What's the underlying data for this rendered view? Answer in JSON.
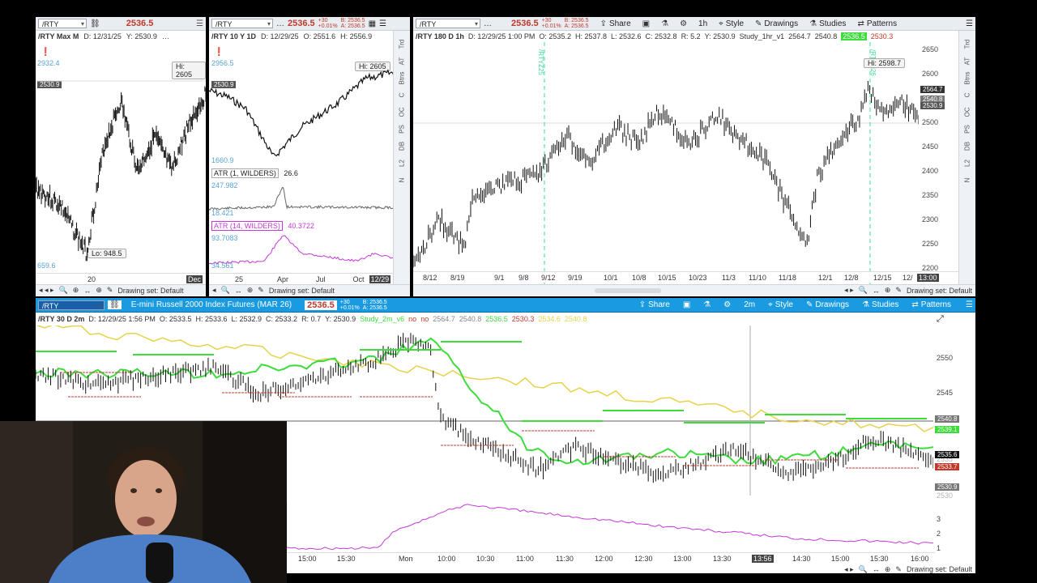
{
  "top_left": {
    "symbol": "/RTY",
    "price": "2536.5",
    "info": [
      "/RTY Max M",
      "D: 12/31/25",
      "Y: 2530.9"
    ],
    "hi_label": "Hi: 2605",
    "lo_label": "Lo: 948.5",
    "axis_top": "2932.4",
    "axis_bottom": "659.6",
    "cur_tag": "2530.9",
    "x_ticks": [
      "20",
      "Dec"
    ],
    "drawing_set": "Drawing set: Default"
  },
  "top_mid": {
    "symbol": "/RTY",
    "price": "2536.5",
    "chg1": "+30",
    "chg2": "+0.01%",
    "bid": "B: 2536.5",
    "ask": "A: 2536.5",
    "info": [
      "/RTY 10 Y 1D",
      "D: 12/29/25",
      "O: 2551.6",
      "H: 2556.9"
    ],
    "hi_label": "Hi: 2605",
    "axis_top": "2956.5",
    "axis_bottom": "1660.9",
    "cur_tag": "2530.9",
    "atr1_label": "ATR (1, WILDERS)",
    "atr1_value": "26.6",
    "atr1_top": "247.982",
    "atr1_bottom": "18.421",
    "atr14_label": "ATR (14, WILDERS)",
    "atr14_value": "40.3722",
    "atr14_top": "93.7083",
    "atr14_bottom": "34.561",
    "x_ticks": [
      "25",
      "Apr",
      "Jul",
      "Oct",
      "12/29"
    ],
    "drawing_set": "Drawing set: Default",
    "side_tabs": [
      "Trd",
      "AT",
      "Btns",
      "C",
      "OC",
      "PS",
      "DB",
      "L2",
      "N"
    ]
  },
  "top_right": {
    "symbol": "/RTY",
    "price": "2536.5",
    "chg1": "+30",
    "chg2": "+0.01%",
    "bid": "B: 2536.5",
    "ask": "A: 2536.5",
    "toolbar": {
      "share": "Share",
      "interval": "1h",
      "style": "Style",
      "drawings": "Drawings",
      "studies": "Studies",
      "patterns": "Patterns"
    },
    "info": [
      "/RTY 180 D 1h",
      "D: 12/29/25 1:00 PM",
      "O: 2535.2",
      "H: 2537.8",
      "L: 2532.6",
      "C: 2532.8",
      "R: 5.2",
      "Y: 2530.9",
      "Study_1hr_v1",
      "2564.7",
      "2540.8",
      "2536.5",
      "2530.3"
    ],
    "hi_label": "Hi: 2598.7",
    "vline_label_1": "/RTYZ25",
    "vline_label_2": "/RTYH26",
    "y_ticks": [
      "2650",
      "2600",
      "2550",
      "2500",
      "2450",
      "2400",
      "2350",
      "2300",
      "2250",
      "2200"
    ],
    "price_tags": [
      "2564.7",
      "2540.8",
      "2530.9"
    ],
    "x_ticks": [
      "8/12",
      "8/19",
      "9/1",
      "9/8",
      "9/12",
      "9/19",
      "10/1",
      "10/8",
      "10/15",
      "10/23",
      "11/3",
      "11/10",
      "11/18",
      "12/1",
      "12/8",
      "12/15",
      "12/"
    ],
    "time_tag": "13:00",
    "drawing_set": "Drawing set: Default"
  },
  "bottom": {
    "symbol": "/RTY",
    "description": "E-mini Russell 2000 Index Futures (MAR 26)",
    "price": "2536.5",
    "chg1": "+30",
    "chg2": "+0.01%",
    "bid": "B: 2536.5",
    "ask": "A: 2536.5",
    "toolbar": {
      "share": "Share",
      "interval": "2m",
      "style": "Style",
      "drawings": "Drawings",
      "studies": "Studies",
      "patterns": "Patterns"
    },
    "info": [
      "/RTY 30 D 2m",
      "D: 12/29/25 1:56 PM",
      "O: 2533.5",
      "H: 2533.6",
      "L: 2532.9",
      "C: 2533.2",
      "R: 0.7",
      "Y: 2530.9"
    ],
    "study": [
      "Study_2m_v6",
      "no",
      "no",
      "2564.7",
      "2540.8",
      "2536.5",
      "2530.3",
      "2534.6",
      "2540.8"
    ],
    "y_ticks": [
      "2550",
      "2545",
      "2535",
      "2530"
    ],
    "price_tags": [
      "2540.8",
      "2539.1",
      "2535.6",
      "2533.7",
      "2530.9"
    ],
    "osc_ticks": [
      "3",
      "2",
      "1"
    ],
    "x_ticks": [
      "15:00",
      "15:30",
      "Mon",
      "10:00",
      "10:30",
      "11:00",
      "11:30",
      "12:00",
      "12:30",
      "13:00",
      "13:30",
      "13:56",
      "14:30",
      "15:00",
      "15:30",
      "16:00"
    ],
    "drawing_set": "Drawing set: Default"
  },
  "colors": {
    "accent_blue": "#1a9ae0",
    "down_red": "#c0392b",
    "up_green": "#27ae60",
    "ma_green": "#3ddc3d",
    "ma_yellow": "#e8d24a",
    "osc_magenta": "#c43ad6"
  }
}
